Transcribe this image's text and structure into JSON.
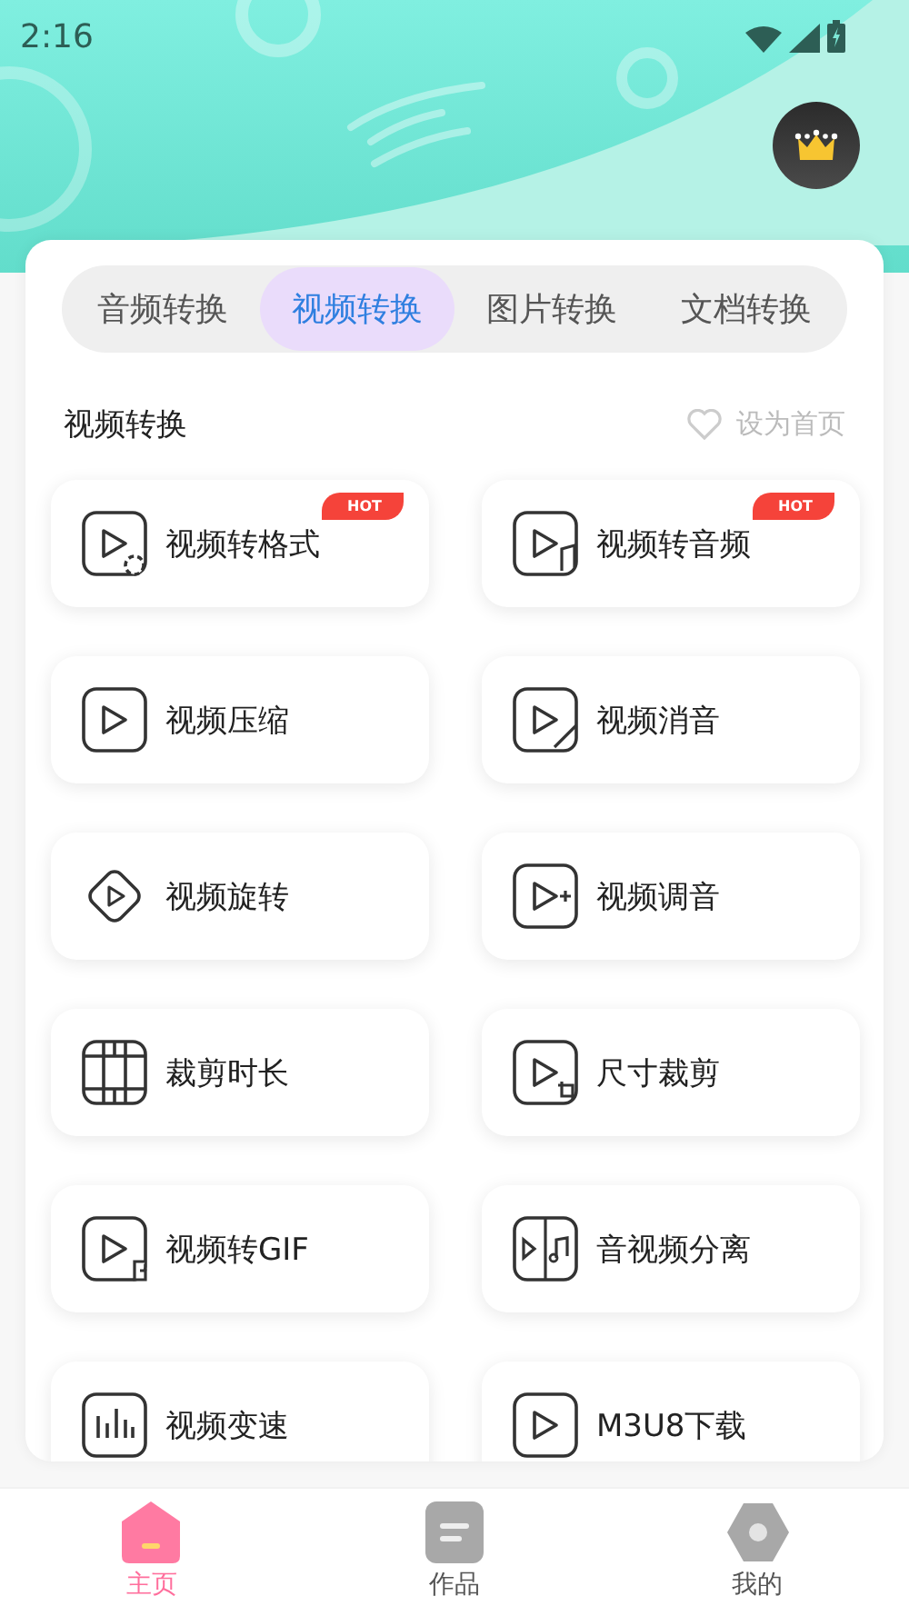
{
  "status_bar": {
    "time": "2:16"
  },
  "tabs": [
    {
      "label": "音频转换",
      "selected": false
    },
    {
      "label": "视频转换",
      "selected": true
    },
    {
      "label": "图片转换",
      "selected": false
    },
    {
      "label": "文档转换",
      "selected": false
    }
  ],
  "section": {
    "title": "视频转换",
    "set_home": "设为首页"
  },
  "tools": [
    {
      "label": "视频转格式",
      "badge": "HOT"
    },
    {
      "label": "视频转音频",
      "badge": "HOT"
    },
    {
      "label": "视频压缩"
    },
    {
      "label": "视频消音"
    },
    {
      "label": "视频旋转"
    },
    {
      "label": "视频调音"
    },
    {
      "label": "裁剪时长"
    },
    {
      "label": "尺寸裁剪"
    },
    {
      "label": "视频转GIF"
    },
    {
      "label": "音视频分离"
    },
    {
      "label": "视频变速"
    },
    {
      "label": "M3U8下载"
    }
  ],
  "bottom_nav": [
    {
      "label": "主页",
      "selected": true
    },
    {
      "label": "作品",
      "selected": false
    },
    {
      "label": "我的",
      "selected": false
    }
  ]
}
